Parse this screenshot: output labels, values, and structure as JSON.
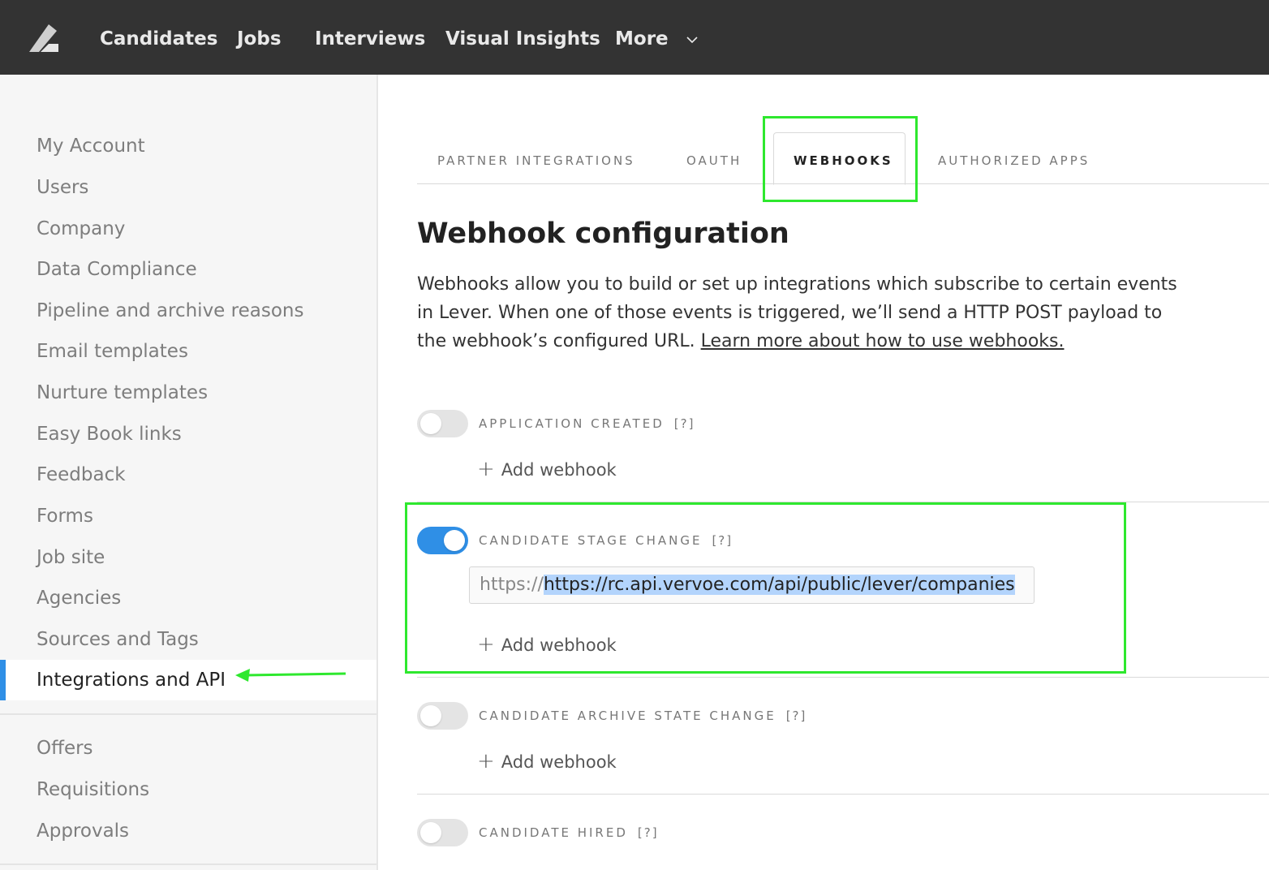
{
  "nav": {
    "logo": "lever-logo-icon",
    "items": [
      "Candidates",
      "Jobs",
      "Interviews",
      "Visual Insights",
      "More"
    ]
  },
  "sidebar": {
    "items": [
      "My Account",
      "Users",
      "Company",
      "Data Compliance",
      "Pipeline and archive reasons",
      "Email templates",
      "Nurture templates",
      "Easy Book links",
      "Feedback",
      "Forms",
      "Job site",
      "Agencies",
      "Sources and Tags",
      "Integrations and API"
    ],
    "active": "Integrations and API",
    "secondary": [
      "Offers",
      "Requisitions",
      "Approvals"
    ]
  },
  "tabs": [
    "PARTNER INTEGRATIONS",
    "OAUTH",
    "WEBHOOKS",
    "AUTHORIZED APPS"
  ],
  "active_tab": "WEBHOOKS",
  "page": {
    "title": "Webhook configuration",
    "description": "Webhooks allow you to build or set up integrations which subscribe to certain events in Lever. When one of those events is triggered, we’ll send a HTTP POST payload to the webhook’s configured URL. ",
    "learn_more": "Learn more about how to use webhooks."
  },
  "events": [
    {
      "label": "APPLICATION CREATED",
      "help": "[?]",
      "enabled": false,
      "add_label": "Add webhook"
    },
    {
      "label": "CANDIDATE STAGE CHANGE",
      "help": "[?]",
      "enabled": true,
      "add_label": "Add webhook",
      "url_prefix": "https://",
      "url_value": "https://rc.api.vervoe.com/api/public/lever/companies"
    },
    {
      "label": "CANDIDATE ARCHIVE STATE CHANGE",
      "help": "[?]",
      "enabled": false,
      "add_label": "Add webhook"
    },
    {
      "label": "CANDIDATE HIRED",
      "help": "[?]",
      "enabled": false
    }
  ],
  "colors": {
    "topbar": "#333333",
    "accent": "#2f8fe6",
    "highlight_annotation": "#2ee82e",
    "selection": "#b3d4fc"
  }
}
